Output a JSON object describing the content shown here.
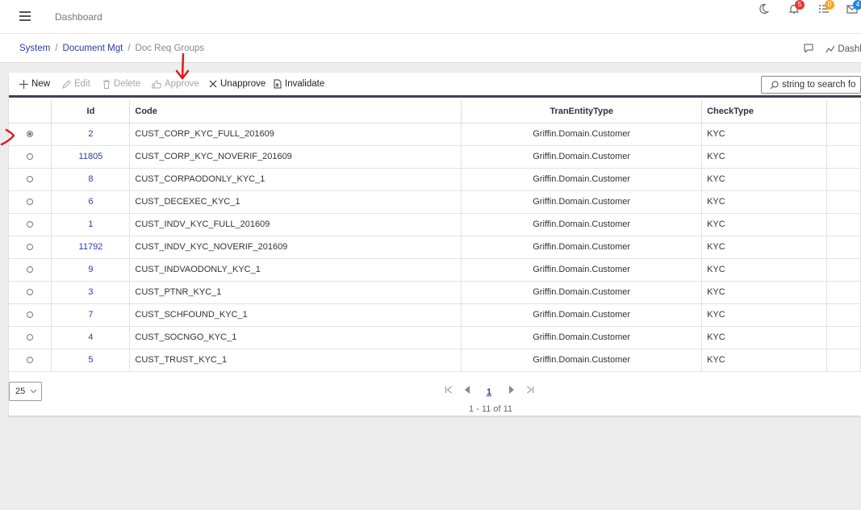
{
  "topbar": {
    "title": "Dashboard",
    "notification_count": "5",
    "tasks_count": "0",
    "messages_count": "4"
  },
  "breadcrumb": {
    "items": [
      "System",
      "Document Mgt"
    ],
    "current": "Doc Req Groups",
    "right_label": "Dashbo"
  },
  "toolbar": {
    "new_label": "New",
    "edit_label": "Edit",
    "delete_label": "Delete",
    "approve_label": "Approve",
    "unapprove_label": "Unapprove",
    "invalidate_label": "Invalidate",
    "search_placeholder": "string to search for"
  },
  "table": {
    "headers": {
      "id": "Id",
      "code": "Code",
      "tran": "TranEntityType",
      "check": "CheckType"
    },
    "rows": [
      {
        "id": "2",
        "code": "CUST_CORP_KYC_FULL_201609",
        "tran": "Griffin.Domain.Customer",
        "check": "KYC",
        "selected": true
      },
      {
        "id": "11805",
        "code": "CUST_CORP_KYC_NOVERIF_201609",
        "tran": "Griffin.Domain.Customer",
        "check": "KYC",
        "selected": false
      },
      {
        "id": "8",
        "code": "CUST_CORPAODONLY_KYC_1",
        "tran": "Griffin.Domain.Customer",
        "check": "KYC",
        "selected": false
      },
      {
        "id": "6",
        "code": "CUST_DECEXEC_KYC_1",
        "tran": "Griffin.Domain.Customer",
        "check": "KYC",
        "selected": false
      },
      {
        "id": "1",
        "code": "CUST_INDV_KYC_FULL_201609",
        "tran": "Griffin.Domain.Customer",
        "check": "KYC",
        "selected": false
      },
      {
        "id": "11792",
        "code": "CUST_INDV_KYC_NOVERIF_201609",
        "tran": "Griffin.Domain.Customer",
        "check": "KYC",
        "selected": false
      },
      {
        "id": "9",
        "code": "CUST_INDVAODONLY_KYC_1",
        "tran": "Griffin.Domain.Customer",
        "check": "KYC",
        "selected": false
      },
      {
        "id": "3",
        "code": "CUST_PTNR_KYC_1",
        "tran": "Griffin.Domain.Customer",
        "check": "KYC",
        "selected": false
      },
      {
        "id": "7",
        "code": "CUST_SCHFOUND_KYC_1",
        "tran": "Griffin.Domain.Customer",
        "check": "KYC",
        "selected": false
      },
      {
        "id": "4",
        "code": "CUST_SOCNGO_KYC_1",
        "tran": "Griffin.Domain.Customer",
        "check": "KYC",
        "selected": false
      },
      {
        "id": "5",
        "code": "CUST_TRUST_KYC_1",
        "tran": "Griffin.Domain.Customer",
        "check": "KYC",
        "selected": false
      }
    ]
  },
  "pagination": {
    "page_size": "25",
    "current_page": "1",
    "info": "1 - 11 of 11"
  },
  "colors": {
    "link": "#2b3aa8",
    "annotation": "#e0191b",
    "toolbar_rule": "#3b4454",
    "badge_red": "#e53935",
    "badge_orange": "#f5a623",
    "badge_blue": "#1e88e5"
  }
}
